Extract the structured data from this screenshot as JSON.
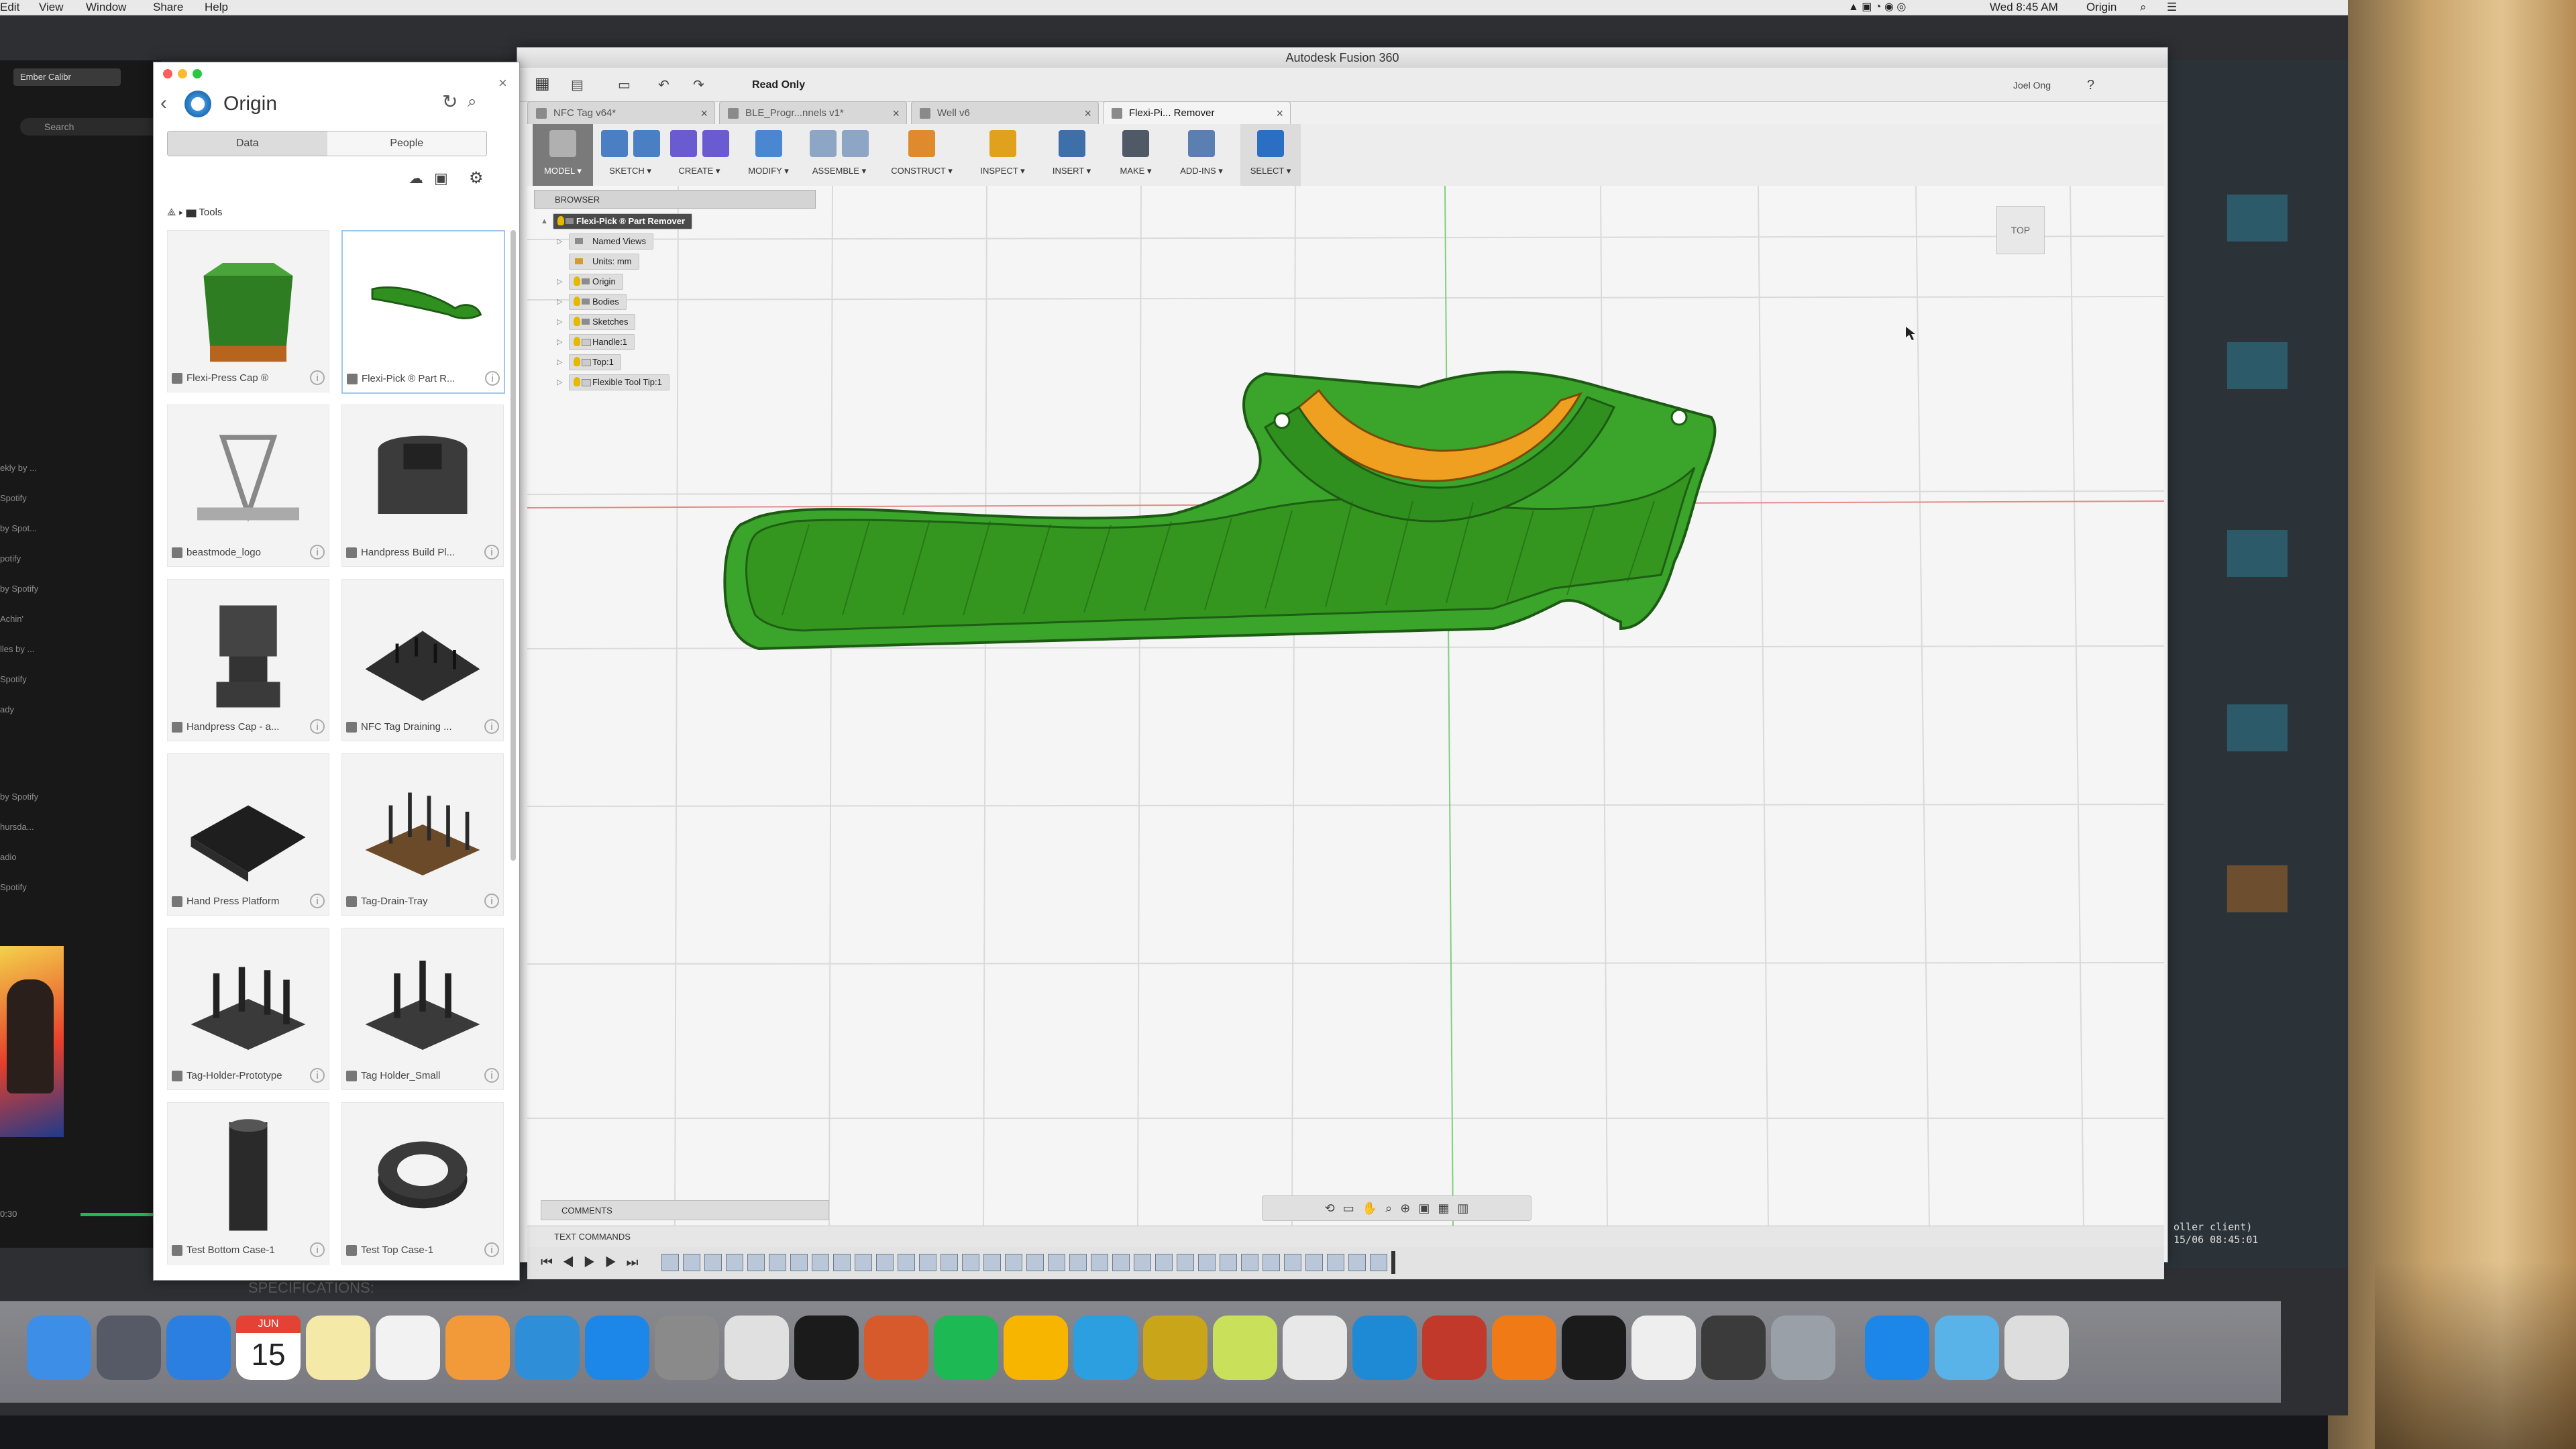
{
  "menubar": {
    "items": [
      "Edit",
      "View",
      "Window",
      "Share",
      "Help"
    ],
    "right": {
      "time": "Wed 8:45 AM",
      "app": "Origin"
    }
  },
  "background_left": {
    "tab_label": "Ember Calibr",
    "search_placeholder": "Search",
    "list": [
      "ekly by ...",
      "Spotify",
      "by Spot...",
      "potify",
      "by Spotify",
      "Achin'",
      "lles by ...",
      "Spotify",
      "ady",
      "by Spotify",
      "hursda...",
      "adio",
      "Spotify"
    ],
    "time_elapsed": "0:30"
  },
  "terminal": {
    "lines": [
      "oller client)",
      "15/06 08:45:01"
    ]
  },
  "data_panel": {
    "title": "Origin",
    "tabs": [
      "Data",
      "People"
    ],
    "breadcrumb": "Tools",
    "items": [
      {
        "label": "Flexi-Press Cap ®",
        "thumb": "cap"
      },
      {
        "label": "Flexi-Pick ® Part R...",
        "thumb": "pick"
      },
      {
        "label": "beastmode_logo",
        "thumb": "logo"
      },
      {
        "label": "Handpress Build Pl...",
        "thumb": "build"
      },
      {
        "label": "Handpress Cap - a...",
        "thumb": "hcap"
      },
      {
        "label": "NFC Tag Draining ...",
        "thumb": "drain"
      },
      {
        "label": "Hand Press Platform",
        "thumb": "platform"
      },
      {
        "label": "Tag-Drain-Tray",
        "thumb": "tray"
      },
      {
        "label": "Tag-Holder-Prototype",
        "thumb": "holder"
      },
      {
        "label": "Tag Holder_Small",
        "thumb": "holder2"
      },
      {
        "label": "Test Bottom Case-1",
        "thumb": "bottom"
      },
      {
        "label": "Test Top Case-1",
        "thumb": "top"
      }
    ]
  },
  "fusion": {
    "window_title": "Autodesk Fusion 360",
    "status": "Read Only",
    "user": "Joel Ong",
    "doc_tabs": [
      {
        "label": "NFC Tag v64*",
        "active": false
      },
      {
        "label": "BLE_Progr...nnels v1*",
        "active": false
      },
      {
        "label": "Well v6",
        "active": false
      },
      {
        "label": "Flexi-Pi... Remover",
        "active": true
      }
    ],
    "toolbar": [
      {
        "label": "MODEL ▾",
        "icon": "model-icon",
        "color": "#b0b0b0"
      },
      {
        "label": "SKETCH ▾",
        "icon": "sketch-icon",
        "color": "#4b7fc4"
      },
      {
        "label": "CREATE ▾",
        "icon": "create-icon",
        "color": "#6a5bd1"
      },
      {
        "label": "MODIFY ▾",
        "icon": "modify-icon",
        "color": "#4a87d0"
      },
      {
        "label": "ASSEMBLE ▾",
        "icon": "assemble-icon",
        "color": "#8ea6c6"
      },
      {
        "label": "CONSTRUCT ▾",
        "icon": "construct-icon",
        "color": "#e08a2e"
      },
      {
        "label": "INSPECT ▾",
        "icon": "inspect-icon",
        "color": "#e0a11c"
      },
      {
        "label": "INSERT ▾",
        "icon": "insert-icon",
        "color": "#3d6fa8"
      },
      {
        "label": "MAKE ▾",
        "icon": "make-icon",
        "color": "#505a66"
      },
      {
        "label": "ADD-INS ▾",
        "icon": "addins-icon",
        "color": "#5a7fb0"
      },
      {
        "label": "SELECT ▾",
        "icon": "select-icon",
        "color": "#2a6fc4"
      }
    ],
    "browser": {
      "header": "BROWSER",
      "root": "Flexi-Pick ® Part Remover",
      "nodes": [
        "Named Views",
        "Units: mm",
        "Origin",
        "Bodies",
        "Sketches",
        "Handle:1",
        "Top:1",
        "Flexible Tool Tip:1"
      ]
    },
    "viewcube_label": "TOP",
    "comments_label": "COMMENTS",
    "text_commands_label": "TEXT COMMANDS",
    "model_colors": {
      "body": "#3aa52a",
      "edge": "#1d5a14",
      "tip": "#f0a020"
    }
  },
  "dock": {
    "calendar_month": "JUN",
    "calendar_day": "15",
    "apps": [
      "finder-icon",
      "launchpad-icon",
      "safari-icon",
      "calendar-icon",
      "notes-icon",
      "reminders-icon",
      "pages-icon",
      "keynote-icon",
      "appstore-icon",
      "system-prefs-icon",
      "chrome-icon",
      "terminal-icon",
      "powerpoint-icon",
      "spotify-icon",
      "sketch-icon",
      "butterfly-icon",
      "blender-icon",
      "cura-icon",
      "slack-icon",
      "dash-icon",
      "solid-icon",
      "fusion360-icon",
      "terminal2-icon",
      "textedit-icon",
      "calculator-icon",
      "preview-icon",
      "appstore2-icon",
      "downloads-icon",
      "trash-icon"
    ]
  },
  "footer": {
    "specs": "SPECIFICATIONS:"
  }
}
